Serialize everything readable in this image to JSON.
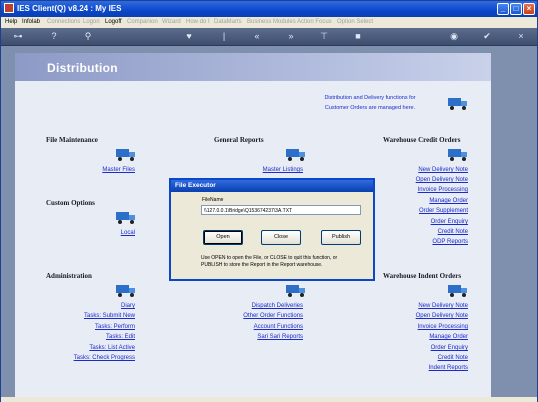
{
  "window": {
    "title": "IES Client(Q) v8.24 : My IES"
  },
  "menu": [
    {
      "label": "Help",
      "active": true
    },
    {
      "label": "Infolab",
      "active": true
    },
    {
      "label": "Connections",
      "active": false
    },
    {
      "label": "Logon",
      "active": false
    },
    {
      "label": "Logoff",
      "active": true
    },
    {
      "label": "Companion",
      "active": false
    },
    {
      "label": "Wizard",
      "active": false
    },
    {
      "label": "How do I",
      "active": false
    },
    {
      "label": "DataMarts",
      "active": false
    },
    {
      "label": "Business Modules",
      "active": false
    },
    {
      "label": "Action Focus",
      "active": false
    },
    {
      "label": "Option Select",
      "active": false
    }
  ],
  "banner": {
    "title": "Distribution"
  },
  "intro": {
    "line1": "Distribution and Delivery functions for",
    "line2": "Customer Orders are managed here."
  },
  "sections": {
    "file_maintenance": {
      "title": "File Maintenance",
      "links": [
        "Master Files"
      ]
    },
    "general_reports": {
      "title": "General Reports",
      "links": [
        "Master Listings"
      ]
    },
    "warehouse_credit_orders": {
      "title": "Warehouse Credit Orders",
      "links": [
        "New Delivery Note",
        "Open Delivery Note",
        "Invoice Processing",
        "Manage Order",
        "Order Supplement",
        "Order Enquiry",
        "Credit Note",
        "ODP Reports"
      ]
    },
    "custom_options": {
      "title": "Custom Options",
      "links": [
        "Local"
      ]
    },
    "administration": {
      "title": "Administration",
      "links": [
        "Diary",
        "Tasks: Submit New",
        "Tasks: Perform",
        "Tasks: Edit",
        "Tasks: List Active",
        "Tasks: Check Progress"
      ]
    },
    "business_modules": {
      "links": [
        "Dispatch Deliveries",
        "Other Order Functions",
        "Account Functions",
        "Sari Sari Reports"
      ]
    },
    "warehouse_indent_orders": {
      "title": "Warehouse Indent Orders",
      "links": [
        "New Delivery Note",
        "Open Delivery Note",
        "Invoice Processing",
        "Manage Order",
        "Order Enquiry",
        "Credit Note",
        "Indent Reports"
      ]
    }
  },
  "dialog": {
    "title": "File Executor",
    "field_label": "FileName",
    "field_value": "\\\\127.0.0.1\\Bridge\\Q153674237\\3A.TXT",
    "buttons": {
      "open": "Open",
      "close": "Close",
      "publish": "Publish"
    },
    "help_line1": "Use OPEN to open the File, or CLOSE to quit this function, or",
    "help_line2": "PUBLISH to store the Report in the Report warehouse."
  },
  "colors": {
    "link": "#1a2bcc",
    "banner": "#8d9ac6",
    "titlebar": "#0b47c9"
  }
}
